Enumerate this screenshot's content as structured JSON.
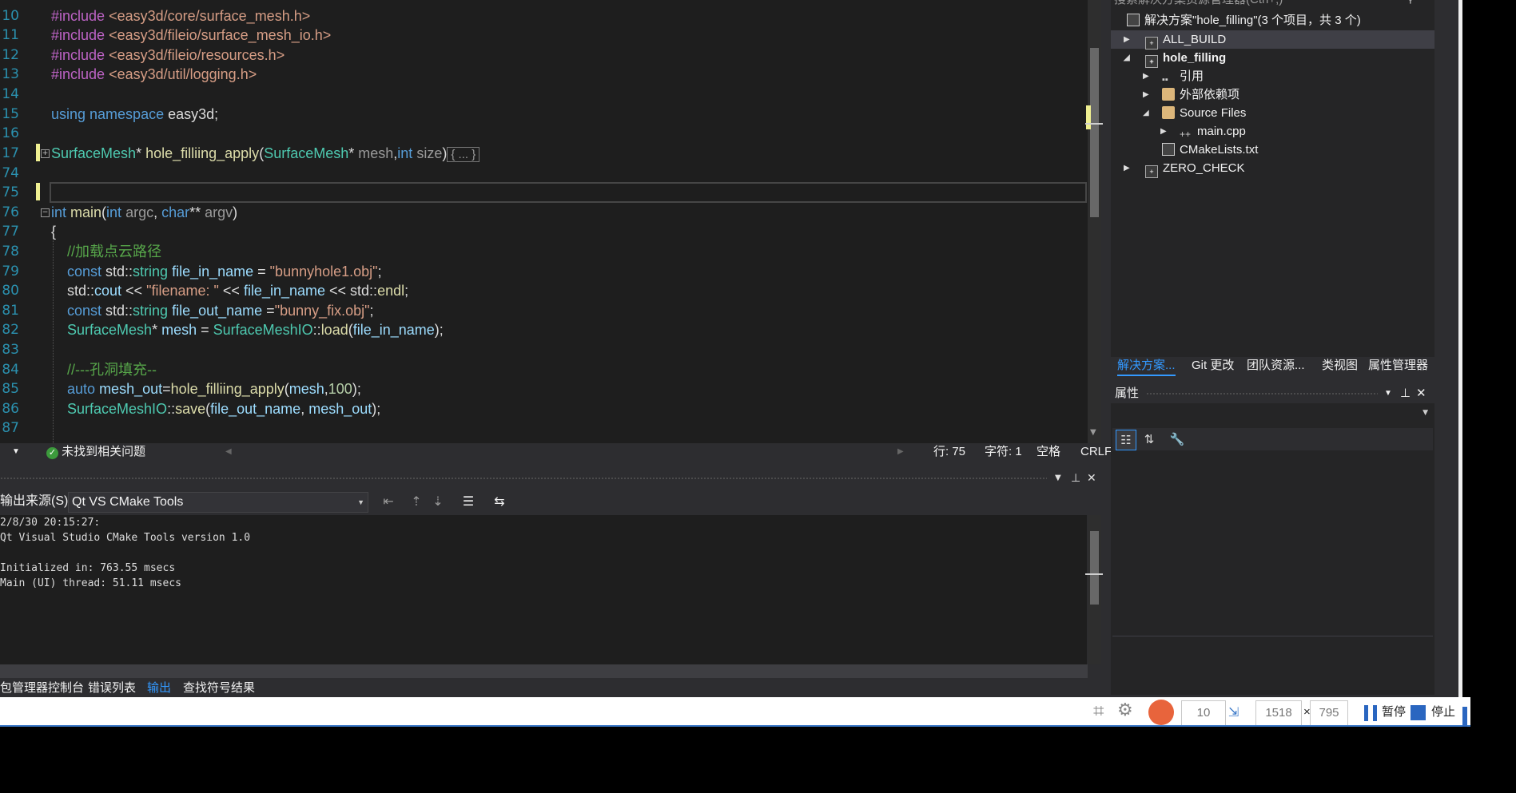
{
  "editor": {
    "lines": [
      {
        "n": "10",
        "code": "#include <easy3d/core/surface_mesh.h>"
      },
      {
        "n": "11",
        "code": "#include <easy3d/fileio/surface_mesh_io.h>"
      },
      {
        "n": "12",
        "code": "#include <easy3d/fileio/resources.h>"
      },
      {
        "n": "13",
        "code": "#include <easy3d/util/logging.h>"
      },
      {
        "n": "14",
        "code": ""
      },
      {
        "n": "15",
        "code": "using namespace easy3d;"
      },
      {
        "n": "16",
        "code": ""
      },
      {
        "n": "17",
        "code": "SurfaceMesh* hole_filliing_apply(SurfaceMesh* mesh,int size){ ... }"
      },
      {
        "n": "74",
        "code": ""
      },
      {
        "n": "75",
        "code": ""
      },
      {
        "n": "76",
        "code": "int main(int argc, char** argv)"
      },
      {
        "n": "77",
        "code": "{"
      },
      {
        "n": "78",
        "code": "//加载点云路径"
      },
      {
        "n": "79",
        "code": "const std::string file_in_name = \"bunnyhole1.obj\";"
      },
      {
        "n": "80",
        "code": "std::cout << \"filename: \" << file_in_name << std::endl;"
      },
      {
        "n": "81",
        "code": "const std::string file_out_name =\"bunny_fix.obj\";"
      },
      {
        "n": "82",
        "code": "SurfaceMesh* mesh = SurfaceMeshIO::load(file_in_name);"
      },
      {
        "n": "83",
        "code": ""
      },
      {
        "n": "84",
        "code": "//---孔洞填充--"
      },
      {
        "n": "85",
        "code": "auto mesh_out=hole_filliing_apply(mesh,100);"
      },
      {
        "n": "86",
        "code": "SurfaceMeshIO::save(file_out_name, mesh_out);"
      },
      {
        "n": "87",
        "code": ""
      }
    ],
    "status": {
      "issues": "未找到相关问题",
      "line": "行: 75",
      "char": "字符: 1",
      "whitespace": "空格",
      "eol": "CRLF"
    }
  },
  "output": {
    "source_label": "输出来源(S):",
    "source_value": "Qt VS CMake Tools",
    "text": "2/8/30 20:15:27:\nQt Visual Studio CMake Tools version 1.0\n\nInitialized in: 763.55 msecs\nMain (UI) thread: 51.11 msecs"
  },
  "bottom_tabs": [
    "包管理器控制台",
    "错误列表",
    "输出",
    "查找符号结果"
  ],
  "bottom_tab_active": "输出",
  "solution": {
    "search_placeholder": "搜索解决方案资源管理器(Ctrl+;)",
    "root": "解决方案\"hole_filling\"(3 个项目，共 3 个)",
    "nodes": [
      "ALL_BUILD",
      "hole_filling",
      "引用",
      "外部依赖项",
      "Source Files",
      "main.cpp",
      "CMakeLists.txt",
      "ZERO_CHECK"
    ],
    "tabs": [
      "解决方案...",
      "Git 更改",
      "团队资源...",
      "类视图",
      "属性管理器"
    ]
  },
  "properties": {
    "title": "属性"
  },
  "recorder": {
    "fps": "10",
    "width": "1518",
    "times": "×",
    "height": "795",
    "pause": "暂停",
    "stop": "停止"
  },
  "colors": {
    "editor_bg": "#1e1e1e",
    "chrome_bg": "#2d2d30",
    "keyword": "#569cd6",
    "type": "#4ec9b0",
    "string": "#d69d85",
    "comment": "#57a64a",
    "line_number": "#2b91af",
    "active_tab": "#3399ff",
    "recorder_accent": "#3a78c8"
  }
}
